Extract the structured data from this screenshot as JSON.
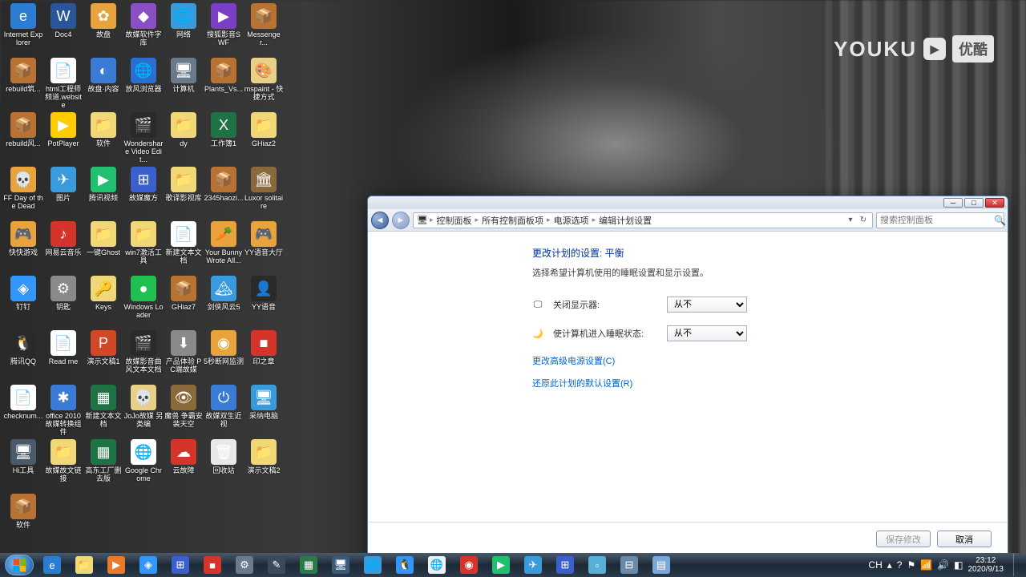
{
  "watermark": {
    "logo": "YOUKU",
    "badge": "优酷"
  },
  "desktop_icons": [
    {
      "label": "Internet Explorer",
      "bg": "#2b7cd3",
      "char": "e"
    },
    {
      "label": "Doc4",
      "bg": "#2a5699",
      "char": "W"
    },
    {
      "label": "故盘",
      "bg": "#e8a33d",
      "char": "✿"
    },
    {
      "label": "故媒软件字库",
      "bg": "#8a4fc4",
      "char": "◆"
    },
    {
      "label": "网络",
      "bg": "#3a9bdc",
      "char": "🌐"
    },
    {
      "label": "搜狐影音SWF",
      "bg": "#7a3fc4",
      "char": "▶"
    },
    {
      "label": "Messenger...",
      "bg": "#b87333",
      "char": "📦"
    },
    {
      "label": "rebuild筑...",
      "bg": "#b87333",
      "char": "📦"
    },
    {
      "label": "html工程师频道.website",
      "bg": "#ffffff",
      "char": "📄"
    },
    {
      "label": "故盘·内容",
      "bg": "#3a7bd5",
      "char": "◐"
    },
    {
      "label": "放风浏览器",
      "bg": "#2a6fcf",
      "char": "🌐"
    },
    {
      "label": "计算机",
      "bg": "#6a7a8a",
      "char": "🖥"
    },
    {
      "label": "Plants_Vs...",
      "bg": "#b87333",
      "char": "📦"
    },
    {
      "label": "mspaint - 快捷方式",
      "bg": "#e8d088",
      "char": "🎨"
    },
    {
      "label": "rebuild风...",
      "bg": "#b87333",
      "char": "📦"
    },
    {
      "label": "PotPlayer",
      "bg": "#ffcc00",
      "char": "▶"
    },
    {
      "label": "软件",
      "bg": "#f0d878",
      "char": "📁"
    },
    {
      "label": "Wondershare Video Edit...",
      "bg": "#2a2a2a",
      "char": "🎬"
    },
    {
      "label": "dy",
      "bg": "#f0d878",
      "char": "📁"
    },
    {
      "label": "工作簿1",
      "bg": "#1f7244",
      "char": "X"
    },
    {
      "label": "GHiaz2",
      "bg": "#f0d878",
      "char": "📁"
    },
    {
      "label": "FF Day of the Dead",
      "bg": "#e8a33d",
      "char": "💀"
    },
    {
      "label": "图片",
      "bg": "#3a9bdc",
      "char": "✈"
    },
    {
      "label": "腾讯视频",
      "bg": "#20c070",
      "char": "▶"
    },
    {
      "label": "故媒魔方",
      "bg": "#3a5fcf",
      "char": "⊞"
    },
    {
      "label": "歌译影视库",
      "bg": "#f0d878",
      "char": "📁"
    },
    {
      "label": "2345haozi...",
      "bg": "#b87333",
      "char": "📦"
    },
    {
      "label": "Luxor solitaire",
      "bg": "#8a6a3a",
      "char": "🏛"
    },
    {
      "label": "快快游戏",
      "bg": "#e8a33d",
      "char": "🎮"
    },
    {
      "label": "网易云音乐",
      "bg": "#d4342a",
      "char": "♪"
    },
    {
      "label": "一键Ghost",
      "bg": "#f0d878",
      "char": "📁"
    },
    {
      "label": "win7激活工具",
      "bg": "#f0d878",
      "char": "📁"
    },
    {
      "label": "新建文本文档",
      "bg": "#ffffff",
      "char": "📄"
    },
    {
      "label": "Your Bunny Wrote All...",
      "bg": "#e8a33d",
      "char": "🥕"
    },
    {
      "label": "YY语音大厅",
      "bg": "#e8a33d",
      "char": "🎮"
    },
    {
      "label": "钉钉",
      "bg": "#3296fa",
      "char": "◈"
    },
    {
      "label": "钥匙",
      "bg": "#8a8a8a",
      "char": "⚙"
    },
    {
      "label": "Keys",
      "bg": "#f0d878",
      "char": "🔑"
    },
    {
      "label": "Windows Loader",
      "bg": "#20c050",
      "char": "●"
    },
    {
      "label": "GHiaz7",
      "bg": "#b87333",
      "char": "📦"
    },
    {
      "label": "剑侠风云5",
      "bg": "#3a9bdc",
      "char": "🏔"
    },
    {
      "label": "YY语音",
      "bg": "#2a2a2a",
      "char": "👤"
    },
    {
      "label": "腾讯QQ",
      "bg": "#2a2a2a",
      "char": "🐧"
    },
    {
      "label": "Read me",
      "bg": "#ffffff",
      "char": "📄"
    },
    {
      "label": "演示文稿1",
      "bg": "#d24726",
      "char": "P"
    },
    {
      "label": "故媒影音曲风文本文档",
      "bg": "#2a2a2a",
      "char": "🎬"
    },
    {
      "label": "产品体验 PC端故媒",
      "bg": "#8a8a8a",
      "char": "⬇"
    },
    {
      "label": "5秒断网监测",
      "bg": "#e8a33d",
      "char": "◉"
    },
    {
      "label": "印之章",
      "bg": "#d4342a",
      "char": "■"
    },
    {
      "label": "checknum...",
      "bg": "#ffffff",
      "char": "📄"
    },
    {
      "label": "office 2010 故媒转换组件",
      "bg": "#3a7bd5",
      "char": "✱"
    },
    {
      "label": "新建文本文档",
      "bg": "#1f7244",
      "char": "▦"
    },
    {
      "label": "JoJo故媒 另类编",
      "bg": "#e8d088",
      "char": "💀"
    },
    {
      "label": "魔兽 争霸安装天空",
      "bg": "#8a6a3a",
      "char": "👁"
    },
    {
      "label": "故媒双生近视",
      "bg": "#3a7bd5",
      "char": "⏻"
    },
    {
      "label": "采纳电脑",
      "bg": "#3a9bdc",
      "char": "🖥"
    },
    {
      "label": "Hi工具",
      "bg": "#4a5a6a",
      "char": "🖥"
    },
    {
      "label": "故媒故文链接",
      "bg": "#f0d878",
      "char": "📁"
    },
    {
      "label": "高东工厂删去版",
      "bg": "#1f7244",
      "char": "▦"
    },
    {
      "label": "Google Chrome",
      "bg": "#ffffff",
      "char": "🌐"
    },
    {
      "label": "云故障",
      "bg": "#d4342a",
      "char": "☁"
    },
    {
      "label": "回收站",
      "bg": "#e8e8e8",
      "char": "🗑"
    },
    {
      "label": "演示文稿2",
      "bg": "#f0d878",
      "char": "📁"
    },
    {
      "label": "软件",
      "bg": "#b87333",
      "char": "📦"
    }
  ],
  "window": {
    "breadcrumb": [
      "控制面板",
      "所有控制面板项",
      "电源选项",
      "编辑计划设置"
    ],
    "search_placeholder": "搜索控制面板",
    "heading": "更改计划的设置: 平衡",
    "desc": "选择希望计算机使用的睡眠设置和显示设置。",
    "row1": {
      "label": "关闭显示器:",
      "value": "从不"
    },
    "row2": {
      "label": "使计算机进入睡眠状态:",
      "value": "从不"
    },
    "select_options": [
      "从不"
    ],
    "link1": "更改高级电源设置(C)",
    "link2": "还原此计划的默认设置(R)",
    "save": "保存修改",
    "cancel": "取消"
  },
  "taskbar": [
    {
      "name": "ie",
      "bg": "#2b7cd3",
      "char": "e"
    },
    {
      "name": "explorer",
      "bg": "#f0d878",
      "char": "📁"
    },
    {
      "name": "wmp",
      "bg": "#e87a2a",
      "char": "▶"
    },
    {
      "name": "dingtalk",
      "bg": "#3296fa",
      "char": "◈"
    },
    {
      "name": "app1",
      "bg": "#3a5fcf",
      "char": "⊞"
    },
    {
      "name": "wps",
      "bg": "#d4342a",
      "char": "■"
    },
    {
      "name": "app2",
      "bg": "#6a7a8a",
      "char": "⚙"
    },
    {
      "name": "app3",
      "bg": "#3a4a5a",
      "char": "✎"
    },
    {
      "name": "app4",
      "bg": "#2a7a4a",
      "char": "▦"
    },
    {
      "name": "app5",
      "bg": "#3a5a7a",
      "char": "🖥"
    },
    {
      "name": "browser1",
      "bg": "#3a9bdc",
      "char": "🌐"
    },
    {
      "name": "qq",
      "bg": "#3296fa",
      "char": "🐧"
    },
    {
      "name": "chrome",
      "bg": "#f0f0f0",
      "char": "🌐"
    },
    {
      "name": "app6",
      "bg": "#d4342a",
      "char": "◉"
    },
    {
      "name": "video",
      "bg": "#20c070",
      "char": "▶"
    },
    {
      "name": "app7",
      "bg": "#3a9bdc",
      "char": "✈"
    },
    {
      "name": "app8",
      "bg": "#3a5fcf",
      "char": "⊞"
    },
    {
      "name": "app9",
      "bg": "#5aafd8",
      "char": "▫"
    },
    {
      "name": "controlpanel",
      "bg": "#6a8aaa",
      "char": "⊟"
    },
    {
      "name": "app10",
      "bg": "#7aa8d8",
      "char": "▤"
    }
  ],
  "tray": {
    "lang": "CH",
    "time": "23:12",
    "date": "2020/9/13"
  }
}
